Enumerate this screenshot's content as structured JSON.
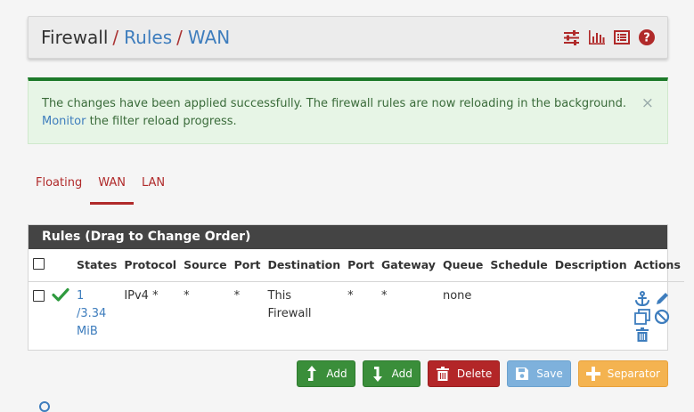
{
  "breadcrumb": {
    "items": [
      "Firewall",
      "Rules",
      "WAN"
    ],
    "separator": "/"
  },
  "header_icons": [
    "sliders-icon",
    "bar-chart-icon",
    "list-icon",
    "help-icon"
  ],
  "alert": {
    "text": "The changes have been applied successfully. The firewall rules are now reloading in the background.",
    "link": "Monitor",
    "text2": "the filter reload progress.",
    "close": "×"
  },
  "tabs": [
    {
      "label": "Floating",
      "active": false
    },
    {
      "label": "WAN",
      "active": true
    },
    {
      "label": "LAN",
      "active": false
    }
  ],
  "rules": {
    "title": "Rules (Drag to Change Order)",
    "columns": [
      "States",
      "Protocol",
      "Source",
      "Port",
      "Destination",
      "Port",
      "Gateway",
      "Queue",
      "Schedule",
      "Description",
      "Actions"
    ],
    "rows": [
      {
        "states_1": "1",
        "states_2": "/3.34",
        "states_3": "MiB",
        "protocol": "IPv4 *",
        "source": "*",
        "port": "*",
        "destination_1": "This",
        "destination_2": "Firewall",
        "dest_port": "*",
        "gateway": "*",
        "queue": "none",
        "schedule": "",
        "description": ""
      }
    ]
  },
  "buttons": {
    "add_top": "Add",
    "add_bottom": "Add",
    "delete": "Delete",
    "save": "Save",
    "separator": "Separator"
  },
  "colors": {
    "accent_red": "#b02a2a",
    "link_blue": "#3e7dbd",
    "success_green": "#1d7a2a",
    "header_dark": "#444444"
  }
}
